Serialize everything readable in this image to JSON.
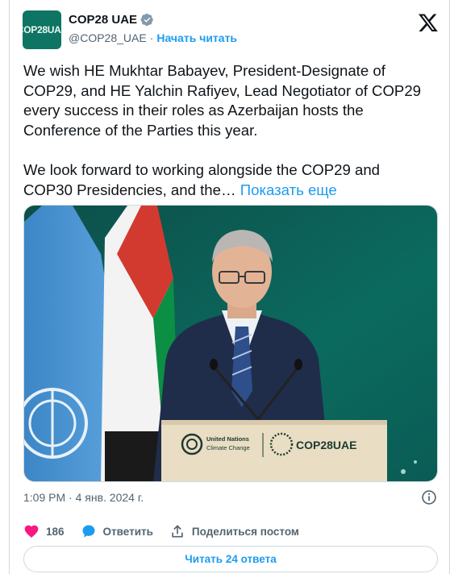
{
  "author": {
    "display_name": "COP28 UAE",
    "handle": "@COP28_UAE",
    "separator": "·",
    "follow_label": "Начать читать",
    "avatar_text": "COP28UAE"
  },
  "tweet": {
    "text": "We wish HE Mukhtar Babayev, President-Designate of COP29, and HE Yalchin Rafiyev, Lead Negotiator of COP29 every success in their roles as Azerbaijan hosts the Conference of the Parties this year.\n\nWe look forward to working alongside the COP29 and COP30 Presidencies, and the… ",
    "show_more_label": "Показать еще"
  },
  "photo": {
    "podium_un_line1": "United Nations",
    "podium_un_line2": "Climate Change",
    "podium_logo": "COP28UAE"
  },
  "meta": {
    "timestamp": "1:09 PM · 4 янв. 2024 г."
  },
  "actions": {
    "like_count": "186",
    "reply_label": "Ответить",
    "share_label": "Поделиться постом"
  },
  "read_replies_label": "Читать 24 ответа",
  "colors": {
    "accent": "#1d9bf0",
    "like": "#f91880",
    "muted": "#536471",
    "brand": "#0e7463"
  },
  "icons": [
    "verified-badge-icon",
    "x-logo-icon",
    "info-icon",
    "heart-icon",
    "reply-bubble-icon",
    "share-icon"
  ]
}
